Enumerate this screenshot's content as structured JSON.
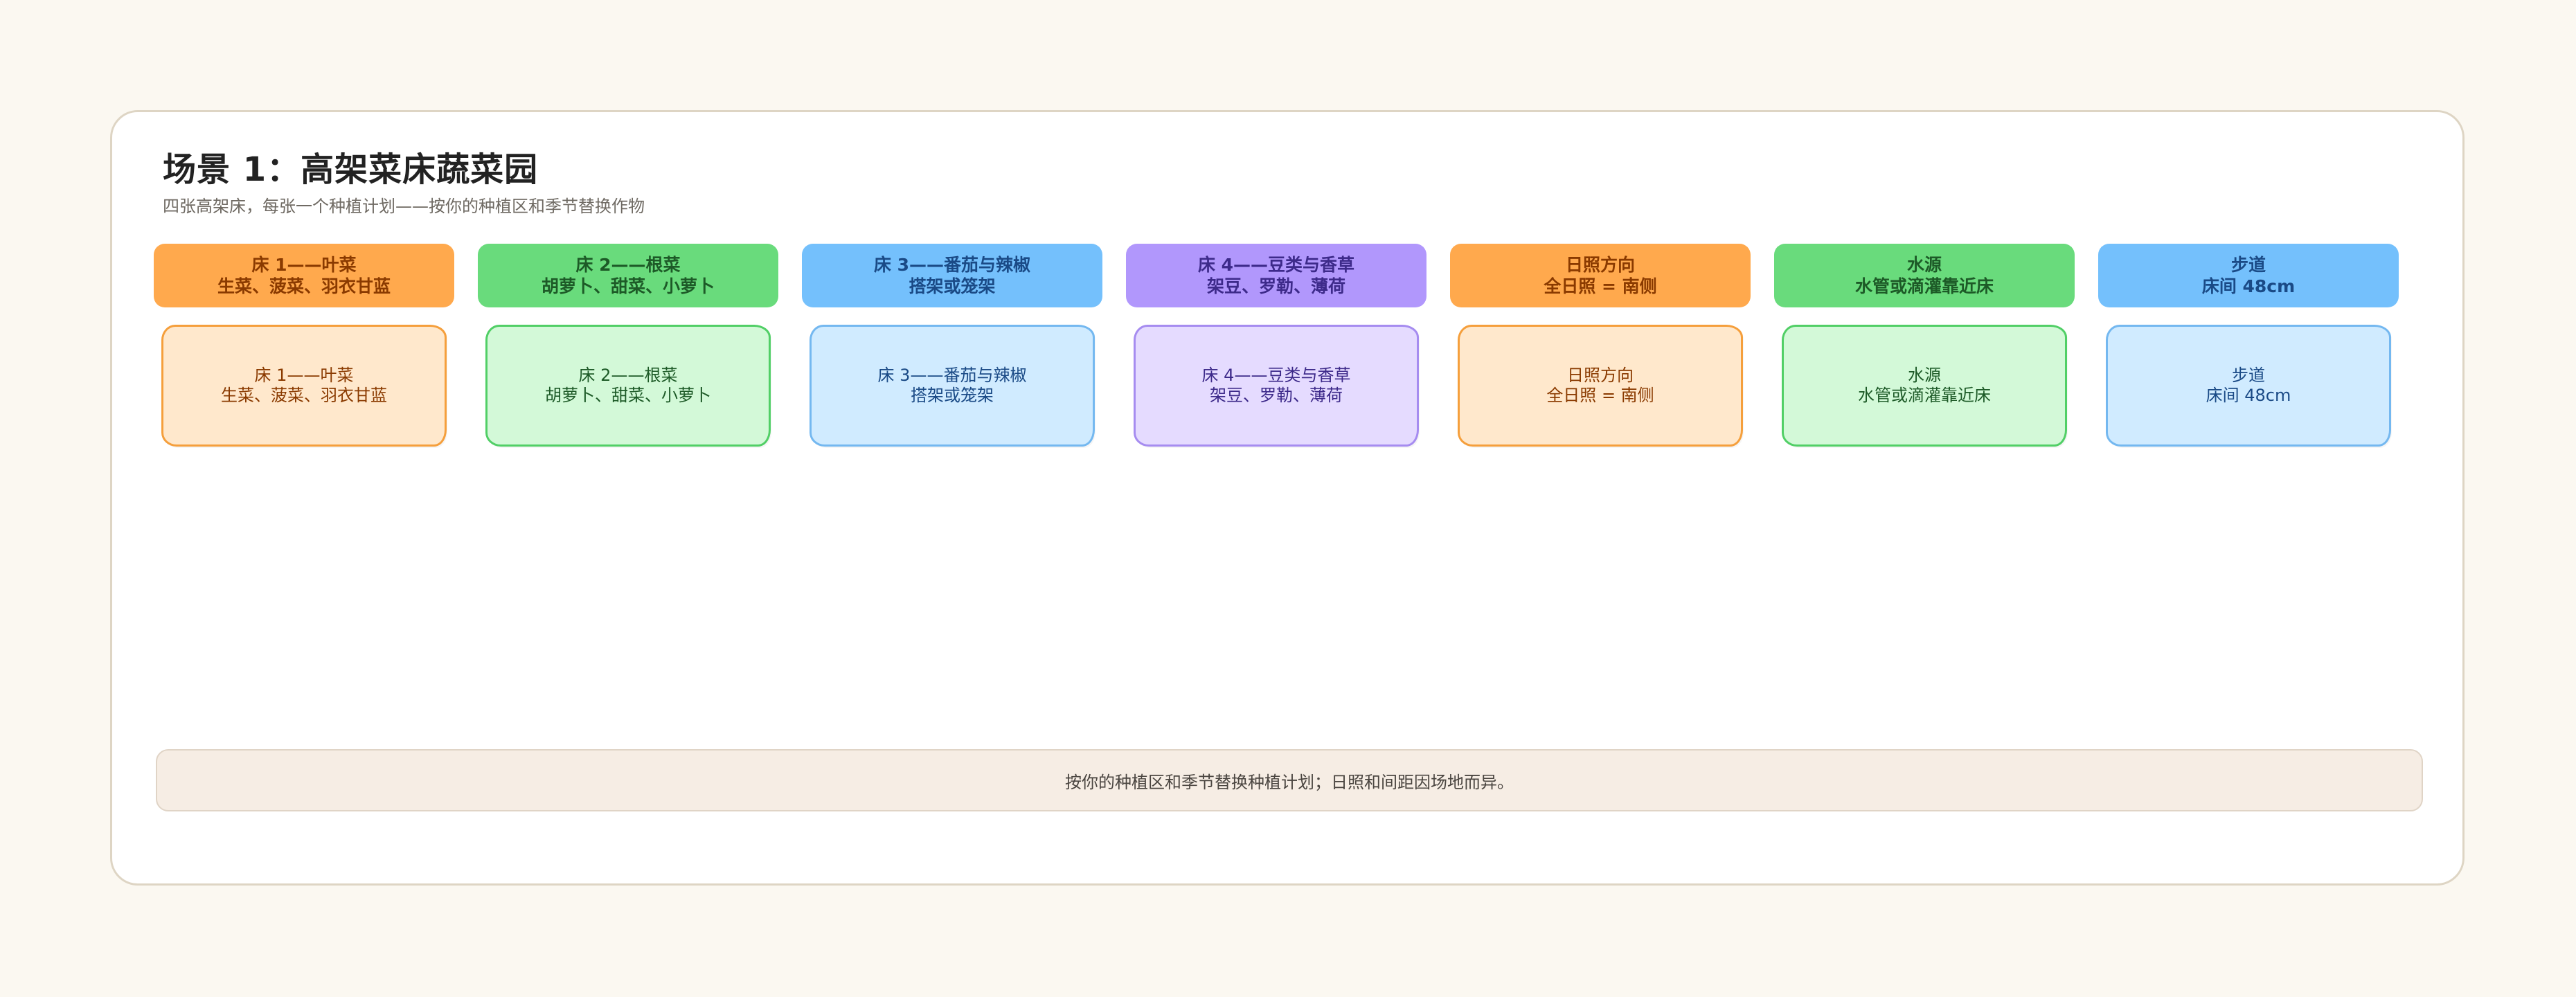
{
  "header": {
    "title": "场景 1：高架菜床蔬菜园",
    "subtitle": "四张高架床，每张一个种植计划——按你的种植区和季节替换作物"
  },
  "columns": [
    {
      "line1": "床 1——叶菜",
      "line2": "生菜、菠菜、羽衣甘蓝",
      "color": "orange"
    },
    {
      "line1": "床 2——根菜",
      "line2": "胡萝卜、甜菜、小萝卜",
      "color": "green"
    },
    {
      "line1": "床 3——番茄与辣椒",
      "line2": "搭架或笼架",
      "color": "blue"
    },
    {
      "line1": "床 4——豆类与香草",
      "line2": "架豆、罗勒、薄荷",
      "color": "purple"
    },
    {
      "line1": "日照方向",
      "line2": "全日照 = 南侧",
      "color": "orange"
    },
    {
      "line1": "水源",
      "line2": "水管或滴灌靠近床",
      "color": "green"
    },
    {
      "line1": "步道",
      "line2": "床间 48cm",
      "color": "blue"
    }
  ],
  "footer": {
    "note": "按你的种植区和季节替换种植计划；日照和间距因场地而异。"
  },
  "palette": {
    "orange": "#ffa94d",
    "green": "#69db7c",
    "blue": "#74c0fc",
    "purple": "#b197fc",
    "background": "#fbf8f1"
  }
}
